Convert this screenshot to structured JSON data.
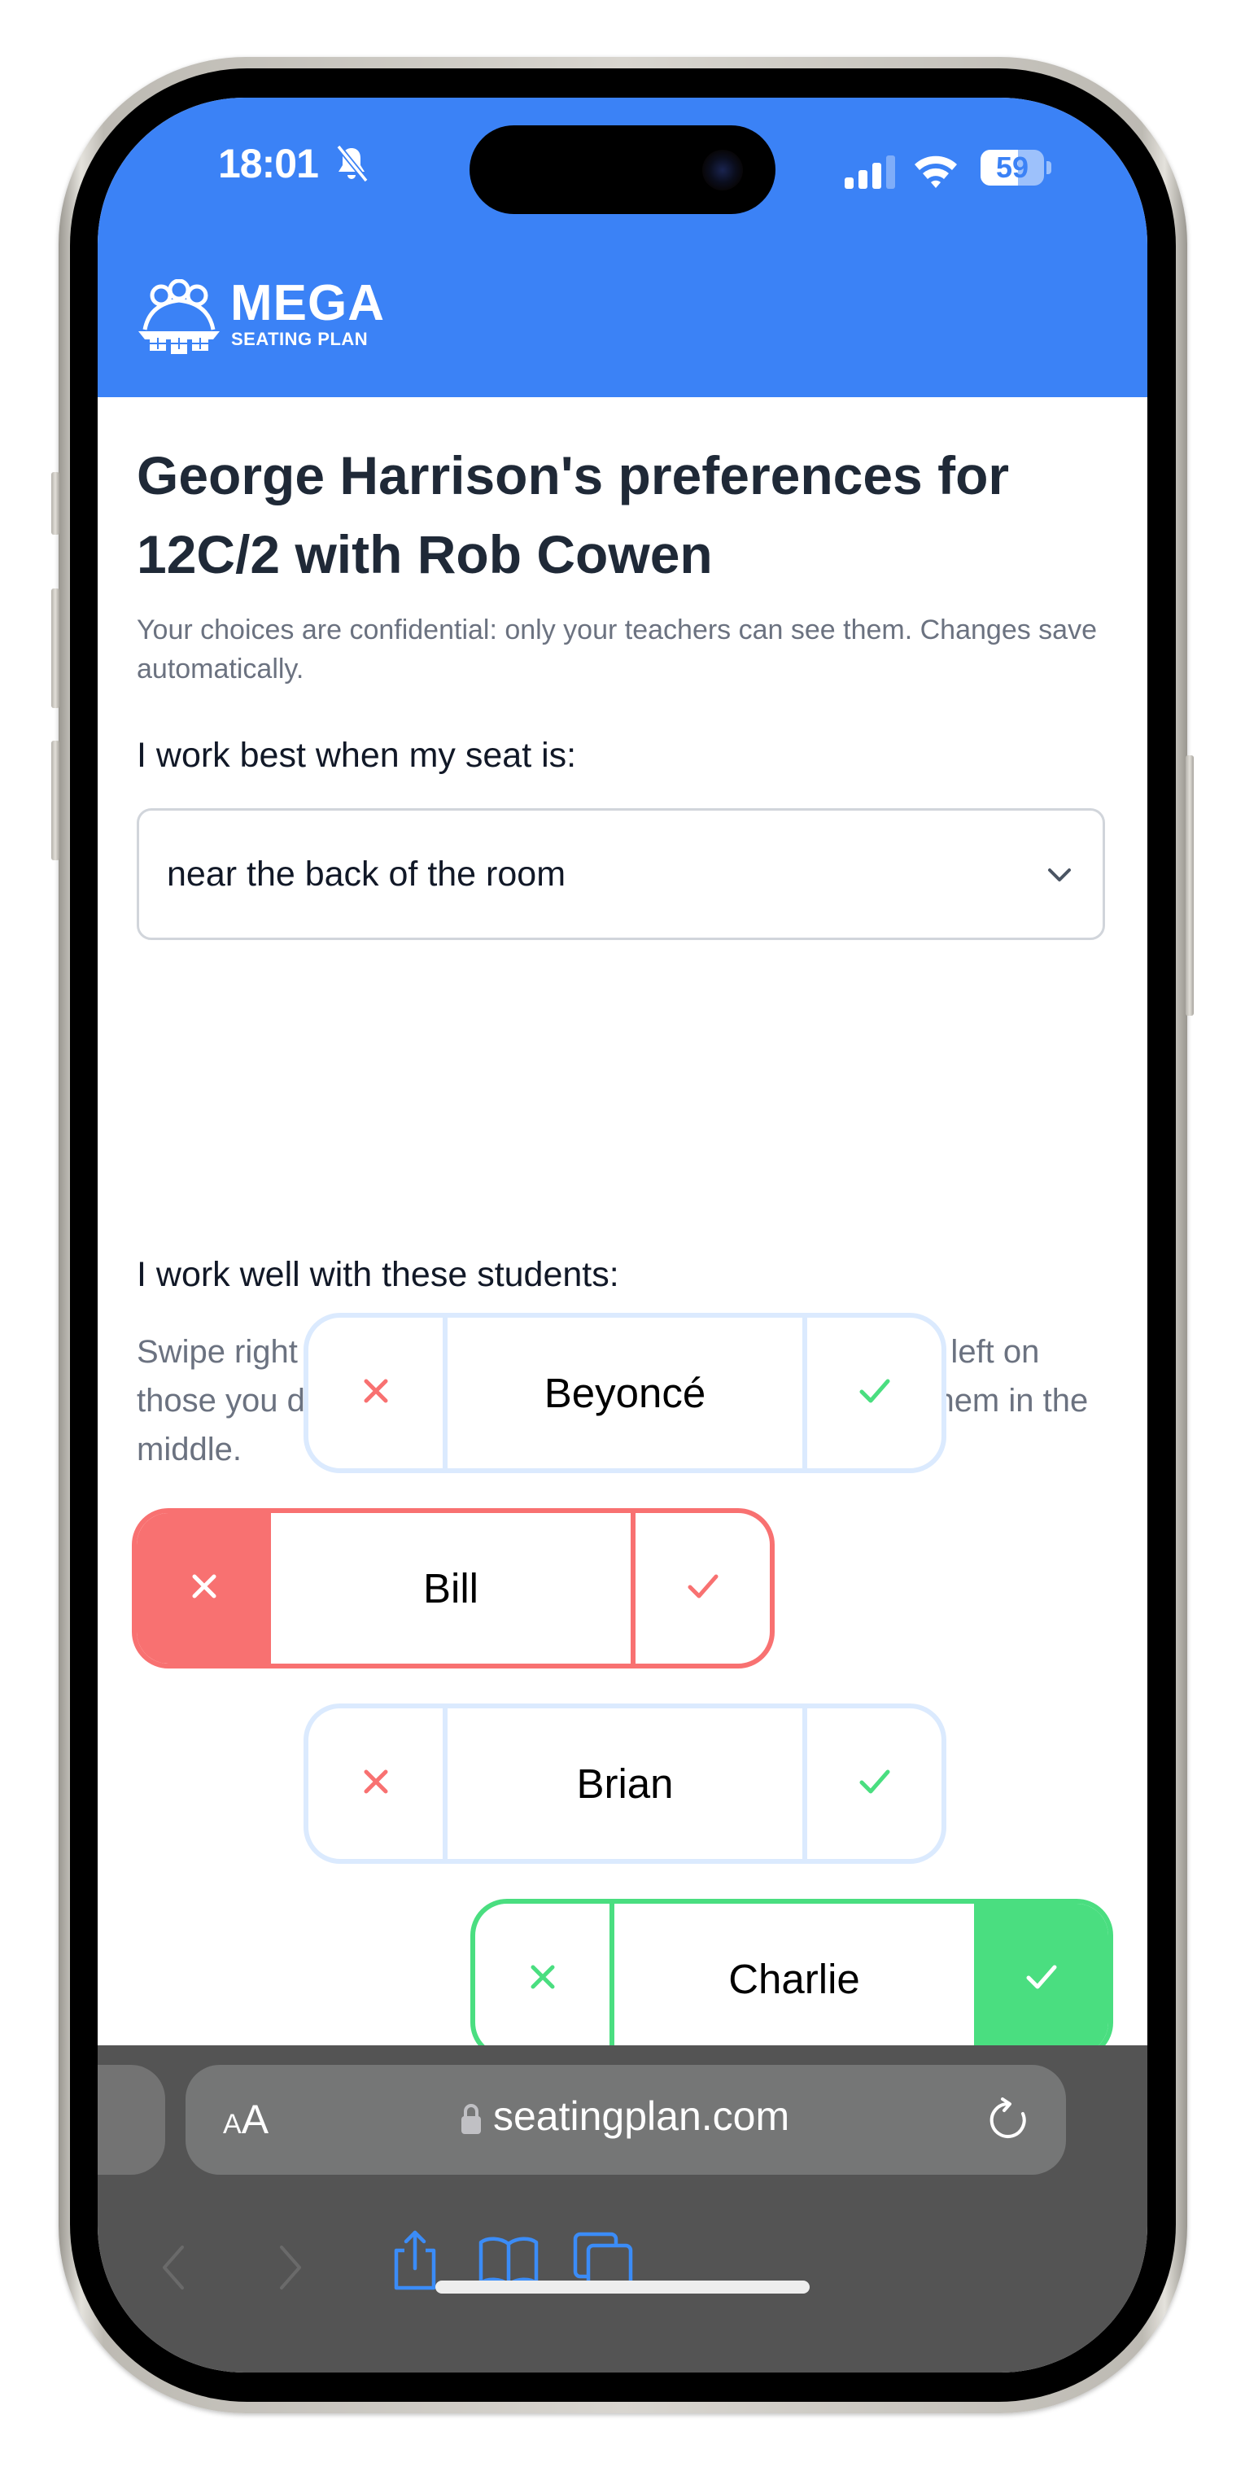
{
  "status_bar": {
    "time": "18:01",
    "silent_icon": "bell-slash-icon",
    "signal_bars_active": 3,
    "signal_bars_total": 4,
    "wifi_icon": "wifi-icon",
    "battery_percent": 59,
    "battery_label": "59"
  },
  "header": {
    "brand_name": "MEGA",
    "brand_subtitle": "SEATING PLAN",
    "logo_icon": "people-desks-logo-icon",
    "color": "#3b82f6"
  },
  "page": {
    "title": "George Harrison's preferences for 12C/2 with Rob Cowen",
    "note": "Your choices are confidential: only your teachers can see them. Changes save automatically.",
    "seat_label": "I work best when my seat is:",
    "seat_select": {
      "value": "near the back of the room"
    },
    "students_label": "I work well with these students:",
    "students_help": "Swipe right on classmates you work well with and swipe left on those you don't work well with. If you don't mind, leave them in the middle."
  },
  "students": [
    {
      "name": "Beyoncé",
      "preference": "neutral"
    },
    {
      "name": "Bill",
      "preference": "avoid"
    },
    {
      "name": "Brian",
      "preference": "neutral"
    },
    {
      "name": "Charlie",
      "preference": "prefer"
    }
  ],
  "colors": {
    "reject": "#f87171",
    "accept": "#4ade80",
    "neutral_border": "#dbeafe",
    "toolbar_icon": "#3b8cf7"
  },
  "browser": {
    "text_size_label_small": "A",
    "text_size_label_large": "A",
    "url": "seatingplan.com",
    "back_icon": "chevron-left-icon",
    "forward_icon": "chevron-right-icon",
    "share_icon": "share-icon",
    "bookmarks_icon": "book-icon",
    "tabs_icon": "tabs-icon"
  }
}
